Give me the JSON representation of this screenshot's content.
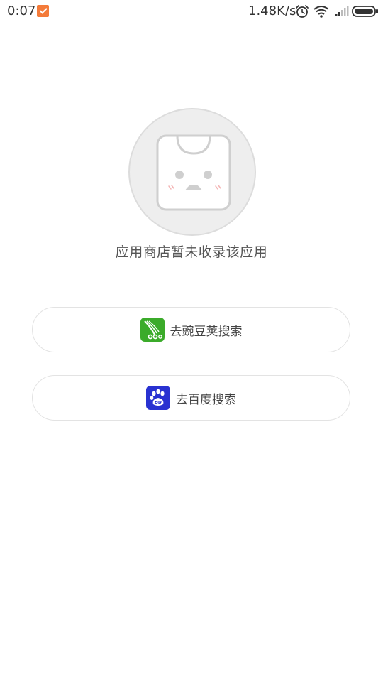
{
  "status_bar": {
    "time": "0:07",
    "network_speed": "1.48K/s",
    "icons": [
      "notification-icon",
      "alarm-icon",
      "wifi-icon",
      "signal-icon",
      "battery-icon"
    ]
  },
  "empty_state": {
    "message": "应用商店暂未收录该应用",
    "illustration": "sad-bag-icon"
  },
  "actions": [
    {
      "label": "去豌豆荚搜索",
      "icon": "wandoujia-icon",
      "icon_color": "#3bab2a"
    },
    {
      "label": "去百度搜索",
      "icon": "baidu-icon",
      "icon_color": "#2932d1"
    }
  ],
  "colors": {
    "background": "#ffffff",
    "notification_accent": "#f47b3a",
    "text": "#555555"
  }
}
